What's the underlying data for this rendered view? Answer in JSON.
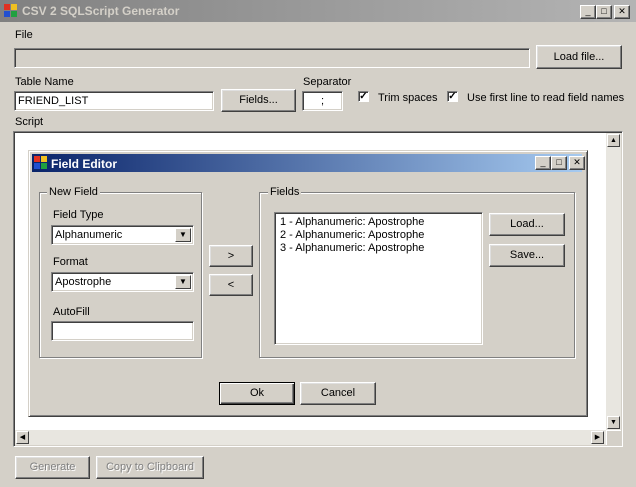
{
  "window": {
    "title": "CSV 2 SQLScript Generator",
    "controls": {
      "minimize": "_",
      "maximize": "□",
      "close": "✕"
    }
  },
  "main": {
    "file_label": "File",
    "file_path": "",
    "load_file_button": "Load file...",
    "table_name_label": "Table Name",
    "table_name_value": "FRIEND_LIST",
    "fields_button": "Fields...",
    "separator_label": "Separator",
    "separator_value": ";",
    "trim_spaces": {
      "label": "Trim spaces",
      "checked": true
    },
    "use_first_line": {
      "label": "Use first line to read field names",
      "checked": true
    },
    "script_label": "Script",
    "generate_button": "Generate",
    "copy_button": "Copy to Clipboard"
  },
  "dialog": {
    "title": "Field Editor",
    "new_field": {
      "group_label": "New Field",
      "field_type_label": "Field Type",
      "field_type_value": "Alphanumeric",
      "format_label": "Format",
      "format_value": "Apostrophe",
      "autofill_label": "AutoFill",
      "autofill_value": ""
    },
    "move_right_button": ">",
    "move_left_button": "<",
    "fields": {
      "group_label": "Fields",
      "items": [
        "1 - Alphanumeric: Apostrophe",
        "2 - Alphanumeric: Apostrophe",
        "3 - Alphanumeric: Apostrophe"
      ],
      "load_button": "Load...",
      "save_button": "Save..."
    },
    "ok_button": "Ok",
    "cancel_button": "Cancel"
  },
  "icons": {
    "app": "app-icon",
    "dropdown": "chevron-down-icon",
    "scroll_up": "arrow-up-icon",
    "scroll_down": "arrow-down-icon",
    "scroll_left": "arrow-left-icon",
    "scroll_right": "arrow-right-icon"
  }
}
